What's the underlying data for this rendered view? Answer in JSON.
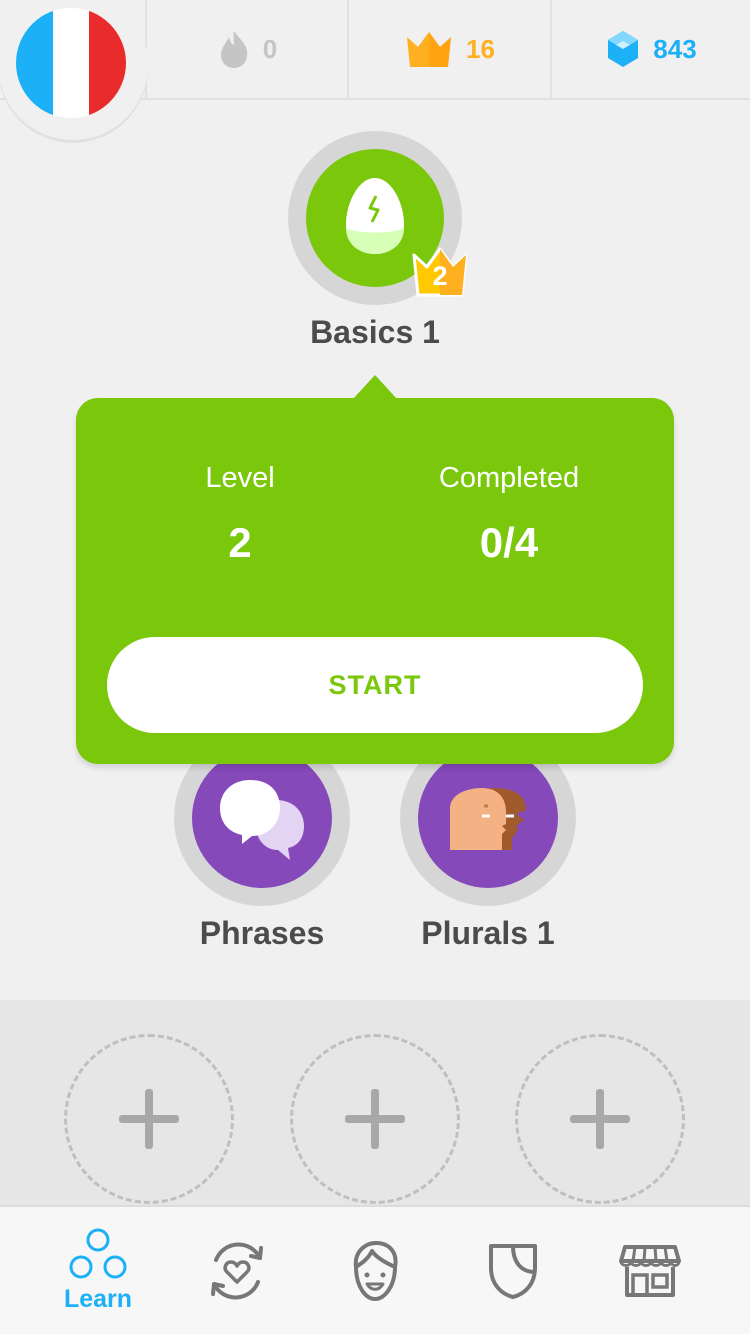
{
  "header": {
    "language_flag": "flag-france-icon",
    "streak": {
      "icon": "flame-icon",
      "value": "0",
      "color": "#c5c5c5"
    },
    "crowns": {
      "icon": "crown-icon",
      "value": "16",
      "color": "#ffb020"
    },
    "gems": {
      "icon": "gem-icon",
      "value": "843",
      "color": "#1cb0f6"
    }
  },
  "skills": {
    "basics": {
      "label": "Basics 1",
      "icon": "cracked-egg-icon",
      "crown_level": "2",
      "color": "#7ac70c"
    },
    "phrases": {
      "label": "Phrases",
      "icon": "speech-bubbles-icon",
      "color": "#8549ba"
    },
    "plurals": {
      "label": "Plurals 1",
      "icon": "two-faces-icon",
      "color": "#8549ba"
    }
  },
  "popover": {
    "level_label": "Level",
    "level_value": "2",
    "completed_label": "Completed",
    "completed_value": "0/4",
    "start_label": "START"
  },
  "locked_slots": [
    "plus-icon",
    "plus-icon",
    "plus-icon"
  ],
  "tabbar": {
    "tabs": [
      {
        "name": "learn",
        "label": "Learn",
        "icon": "learn-circles-icon",
        "active": true
      },
      {
        "name": "practice",
        "icon": "practice-heart-icon"
      },
      {
        "name": "profile",
        "icon": "profile-face-icon"
      },
      {
        "name": "leagues",
        "icon": "shield-icon"
      },
      {
        "name": "shop",
        "icon": "shop-icon"
      }
    ]
  },
  "colors": {
    "background": "#f0f0f0",
    "green": "#7ac70c",
    "purple": "#8549ba",
    "blue": "#1cb0f6",
    "gold": "#ffb020"
  }
}
